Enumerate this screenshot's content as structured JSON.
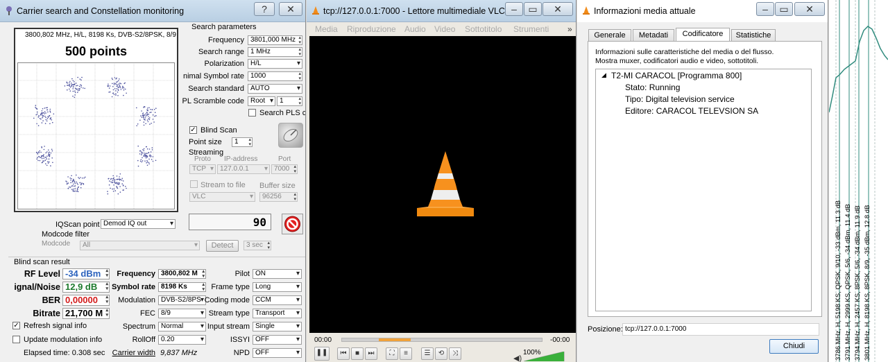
{
  "carrier_window": {
    "title": "Carrier search and Constellation monitoring",
    "help_glyph": "?",
    "close_glyph": "✕",
    "constellation": {
      "info": "3800,802 MHz, H/L, 8198 Ks, DVB-S2/8PSK, 8/9",
      "points_label": "500 points"
    },
    "search_params": {
      "heading": "Search parameters",
      "frequency_label": "Frequency",
      "frequency_value": "3801,000 MHz",
      "search_range_label": "Search range",
      "search_range_value": "1 MHz",
      "polarization_label": "Polarization",
      "polarization_value": "H/L",
      "min_symbol_rate_label": "nimal Symbol rate",
      "min_symbol_rate_value": "1000",
      "search_standard_label": "Search standard",
      "search_standard_value": "AUTO",
      "pl_scramble_label": "PL Scramble code",
      "pl_scramble_mode": "Root",
      "pl_scramble_value": "1",
      "search_pls_label": "Search PLS cc"
    },
    "blind_scan_label": "Blind Scan",
    "point_size_label": "Point size",
    "point_size_value": "1",
    "streaming": {
      "heading": "Streaming",
      "proto_label": "Proto",
      "ip_label": "IP-address",
      "port_label": "Port",
      "proto_value": "TCP",
      "ip_value": "127.0.0.1",
      "port_value": "7000",
      "stream_to_file_label": "Stream to file",
      "buffer_size_label": "Buffer size",
      "player_value": "VLC",
      "buffer_size_value": "96256"
    },
    "counter_value": "90",
    "iqscan_label": "IQScan point",
    "iqscan_value": "Demod IQ out",
    "modcode_filter_label": "Modcode filter",
    "modcode_label": "Modcode",
    "modcode_value": "All",
    "detect_label": "Detect",
    "detect_sec_value": "3 sec",
    "result": {
      "heading": "Blind scan result",
      "rf_level_label": "RF Level",
      "rf_level_value": "-34 dBm",
      "sn_label": "ignal/Noise",
      "sn_value": "12,9 dB",
      "ber_label": "BER",
      "ber_value": "0,00000",
      "bitrate_label": "Bitrate",
      "bitrate_value": "21,700 M",
      "frequency_label": "Frequency",
      "frequency_value": "3800,802 M",
      "symbol_rate_label": "Symbol rate",
      "symbol_rate_value": "8198 Ks",
      "modulation_label": "Modulation",
      "modulation_value": "DVB-S2/8PS",
      "fec_label": "FEC",
      "fec_value": "8/9",
      "spectrum_label": "Spectrum",
      "spectrum_value": "Normal",
      "rolloff_label": "RollOff",
      "rolloff_value": "0.20",
      "carrier_width_label": "Carrier width",
      "carrier_width_value": "9,837 MHz",
      "pilot_label": "Pilot",
      "pilot_value": "ON",
      "frame_type_label": "Frame type",
      "frame_type_value": "Long",
      "coding_mode_label": "Coding mode",
      "coding_mode_value": "CCM",
      "stream_type_label": "Stream type",
      "stream_type_value": "Transport",
      "input_stream_label": "Input stream",
      "input_stream_value": "Single",
      "issyi_label": "ISSYI",
      "issyi_value": "OFF",
      "npd_label": "NPD",
      "npd_value": "OFF"
    },
    "refresh_signal_label": "Refresh signal info",
    "update_modulation_label": "Update modulation info",
    "elapsed_label": "Elapsed time: 0.308 sec"
  },
  "vlc_window": {
    "title": "tcp://127.0.0.1:7000 - Lettore multimediale VLC",
    "menu": [
      "Media",
      "Riproduzione",
      "Audio",
      "Video",
      "Sottotitolo",
      "Strumenti"
    ],
    "menu_more": "»",
    "time_elapsed": "00:00",
    "time_remaining": "-00:00",
    "volume_label": "100%",
    "volume_level": 1.0
  },
  "info_window": {
    "title": "Informazioni media attuale",
    "tabs": [
      "Generale",
      "Metadati",
      "Codificatore",
      "Statistiche"
    ],
    "active_tab": "Codificatore",
    "description_line1": "Informazioni sulle caratteristiche del media o del flusso.",
    "description_line2": "Mostra muxer, codificatori audio e video, sottotitoli.",
    "tree": {
      "root": "T2-MI CARACOL [Programma 800]",
      "children": [
        "Stato: Running",
        "Tipo: Digital television service",
        "Editore: CARACOL TELEVSION SA"
      ]
    },
    "position_label": "Posizione:",
    "position_value": "tcp://127.0.0.1:7000",
    "close_button": "Chiudi"
  },
  "spectrum_strip": {
    "line_color": "#2f8b7d",
    "labels": [
      "3786 MHz, H, 5198 KS, QPSK, 9/10, -33 dBm, 11.3 dB",
      "3791 MHz, H, 2999 KS, QPSK, 5/6, -34 dBm, 11.4 dB",
      "3794 MHz, H, 2457 KS, 8PSK, 5/6, -34 dBm, 11.9 dB",
      "3801 MHz, H, 8198 KS, 8PSK, 8/9, -35 dBm, 12.8 dB"
    ]
  }
}
